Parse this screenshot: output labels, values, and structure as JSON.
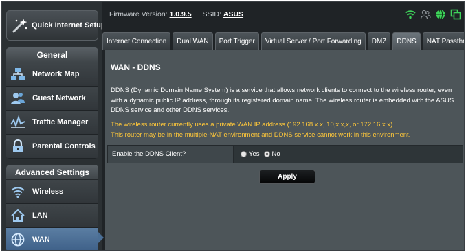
{
  "firmware": {
    "label": "Firmware Version:",
    "version": "1.0.9.5",
    "ssid_label": "SSID:",
    "ssid": "ASUS"
  },
  "status_icons": [
    "wifi-icon",
    "users-icon",
    "globe-icon",
    "copy-icon"
  ],
  "sidebar": {
    "quick_setup": "Quick Internet Setup",
    "general_title": "General",
    "general_items": [
      {
        "label": "Network Map",
        "icon": "network-map-icon"
      },
      {
        "label": "Guest Network",
        "icon": "guest-network-icon"
      },
      {
        "label": "Traffic Manager",
        "icon": "traffic-manager-icon"
      },
      {
        "label": "Parental Controls",
        "icon": "parental-controls-icon"
      }
    ],
    "advanced_title": "Advanced Settings",
    "advanced_items": [
      {
        "label": "Wireless",
        "icon": "wireless-icon"
      },
      {
        "label": "LAN",
        "icon": "lan-icon"
      },
      {
        "label": "WAN",
        "icon": "wan-icon",
        "active": true
      }
    ]
  },
  "tabs": [
    {
      "label": "Internet Connection"
    },
    {
      "label": "Dual WAN"
    },
    {
      "label": "Port Trigger"
    },
    {
      "label": "Virtual Server / Port Forwarding"
    },
    {
      "label": "DMZ"
    },
    {
      "label": "DDNS",
      "active": true
    },
    {
      "label": "NAT Passthrough"
    }
  ],
  "content": {
    "title": "WAN - DDNS",
    "description": "DDNS (Dynamic Domain Name System) is a service that allows network clients to connect to the wireless router, even with a dynamic public IP address, through its registered domain name. The wireless router is embedded with the ASUS DDNS service and other DDNS services.",
    "warning_1": "The wireless router currently uses a private WAN IP address (192.168.x.x, 10,x,x,x, or 172.16.x.x).",
    "warning_2": "This router may be in the multiple-NAT environment and DDNS service cannot work in this environment.",
    "ddns_label": "Enable the DDNS Client?",
    "radio_yes": "Yes",
    "radio_no": "No",
    "selected": "No",
    "apply": "Apply"
  },
  "colors": {
    "accent_active": "#3e6088",
    "warning_text": "#ffc83a",
    "panel": "#4d5559"
  }
}
